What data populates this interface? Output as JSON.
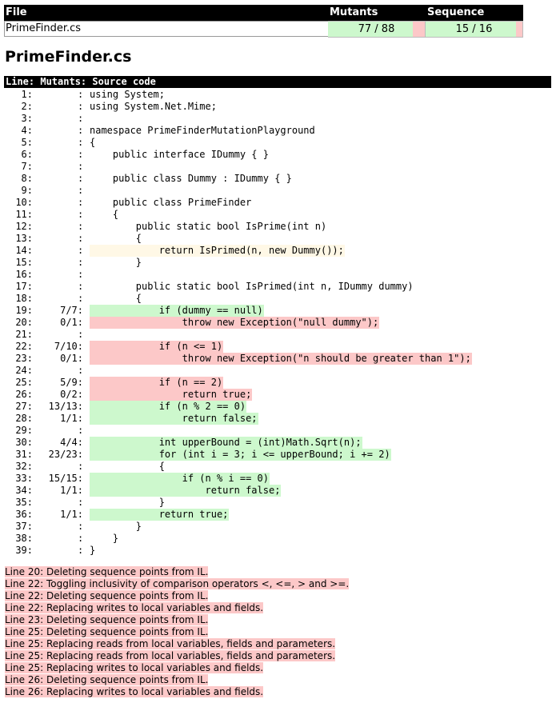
{
  "summary": {
    "headers": {
      "file": "File",
      "mutants": "Mutants",
      "sequence_points": "Sequence points"
    },
    "file_name": "PrimeFinder.cs",
    "mutants": {
      "text": "77 / 88",
      "killed": 77,
      "total": 88
    },
    "sequence_points": {
      "text": "15 / 16",
      "covered": 15,
      "total": 16
    }
  },
  "file_title": "PrimeFinder.cs",
  "source_header": "Line: Mutants: Source code",
  "source_lines": [
    {
      "n": "1:",
      "m": "",
      "code": "using System;",
      "s": ""
    },
    {
      "n": "2:",
      "m": "",
      "code": "using System.Net.Mime;",
      "s": ""
    },
    {
      "n": "3:",
      "m": "",
      "code": "",
      "s": ""
    },
    {
      "n": "4:",
      "m": "",
      "code": "namespace PrimeFinderMutationPlayground",
      "s": ""
    },
    {
      "n": "5:",
      "m": "",
      "code": "{",
      "s": ""
    },
    {
      "n": "6:",
      "m": "",
      "code": "    public interface IDummy { }",
      "s": ""
    },
    {
      "n": "7:",
      "m": "",
      "code": "",
      "s": ""
    },
    {
      "n": "8:",
      "m": "",
      "code": "    public class Dummy : IDummy { }",
      "s": ""
    },
    {
      "n": "9:",
      "m": "",
      "code": "",
      "s": ""
    },
    {
      "n": "10:",
      "m": "",
      "code": "    public class PrimeFinder",
      "s": ""
    },
    {
      "n": "11:",
      "m": "",
      "code": "    {",
      "s": ""
    },
    {
      "n": "12:",
      "m": "",
      "code": "        public static bool IsPrime(int n)",
      "s": ""
    },
    {
      "n": "13:",
      "m": "",
      "code": "        {",
      "s": ""
    },
    {
      "n": "14:",
      "m": "",
      "code": "            return IsPrimed(n, new Dummy());",
      "s": "warn"
    },
    {
      "n": "15:",
      "m": "",
      "code": "        }",
      "s": ""
    },
    {
      "n": "16:",
      "m": "",
      "code": "",
      "s": ""
    },
    {
      "n": "17:",
      "m": "",
      "code": "        public static bool IsPrimed(int n, IDummy dummy)",
      "s": ""
    },
    {
      "n": "18:",
      "m": "",
      "code": "        {",
      "s": ""
    },
    {
      "n": "19:",
      "m": "7/7:",
      "code": "            if (dummy == null)",
      "s": "ok"
    },
    {
      "n": "20:",
      "m": "0/1:",
      "code": "                throw new Exception(\"null dummy\");",
      "s": "bad"
    },
    {
      "n": "21:",
      "m": "",
      "code": "",
      "s": ""
    },
    {
      "n": "22:",
      "m": "7/10:",
      "code": "            if (n <= 1)",
      "s": "bad"
    },
    {
      "n": "23:",
      "m": "0/1:",
      "code": "                throw new Exception(\"n should be greater than 1\");",
      "s": "bad"
    },
    {
      "n": "24:",
      "m": "",
      "code": "",
      "s": ""
    },
    {
      "n": "25:",
      "m": "5/9:",
      "code": "            if (n == 2)",
      "s": "bad"
    },
    {
      "n": "26:",
      "m": "0/2:",
      "code": "                return true;",
      "s": "bad"
    },
    {
      "n": "27:",
      "m": "13/13:",
      "code": "            if (n % 2 == 0)",
      "s": "ok"
    },
    {
      "n": "28:",
      "m": "1/1:",
      "code": "                return false;",
      "s": "ok"
    },
    {
      "n": "29:",
      "m": "",
      "code": "",
      "s": ""
    },
    {
      "n": "30:",
      "m": "4/4:",
      "code": "            int upperBound = (int)Math.Sqrt(n);",
      "s": "ok"
    },
    {
      "n": "31:",
      "m": "23/23:",
      "code": "            for (int i = 3; i <= upperBound; i += 2)",
      "s": "ok"
    },
    {
      "n": "32:",
      "m": "",
      "code": "            {",
      "s": ""
    },
    {
      "n": "33:",
      "m": "15/15:",
      "code": "                if (n % i == 0)",
      "s": "ok"
    },
    {
      "n": "34:",
      "m": "1/1:",
      "code": "                    return false;",
      "s": "ok"
    },
    {
      "n": "35:",
      "m": "",
      "code": "            }",
      "s": ""
    },
    {
      "n": "36:",
      "m": "1/1:",
      "code": "            return true;",
      "s": "ok"
    },
    {
      "n": "37:",
      "m": "",
      "code": "        }",
      "s": ""
    },
    {
      "n": "38:",
      "m": "",
      "code": "    }",
      "s": ""
    },
    {
      "n": "39:",
      "m": "",
      "code": "}",
      "s": ""
    }
  ],
  "messages": [
    "Line 20: Deleting sequence points from IL.",
    "Line 22: Toggling inclusivity of comparison operators <, <=, > and >=.",
    "Line 22: Deleting sequence points from IL.",
    "Line 22: Replacing writes to local variables and fields.",
    "Line 23: Deleting sequence points from IL.",
    "Line 25: Deleting sequence points from IL.",
    "Line 25: Replacing reads from local variables, fields and parameters.",
    "Line 25: Replacing reads from local variables, fields and parameters.",
    "Line 25: Replacing writes to local variables and fields.",
    "Line 26: Deleting sequence points from IL.",
    "Line 26: Replacing writes to local variables and fields."
  ],
  "colors": {
    "covered": "#cdf8cd",
    "uncovered": "#fcc8c8",
    "partial": "#fff8e6",
    "header": "#000000"
  }
}
